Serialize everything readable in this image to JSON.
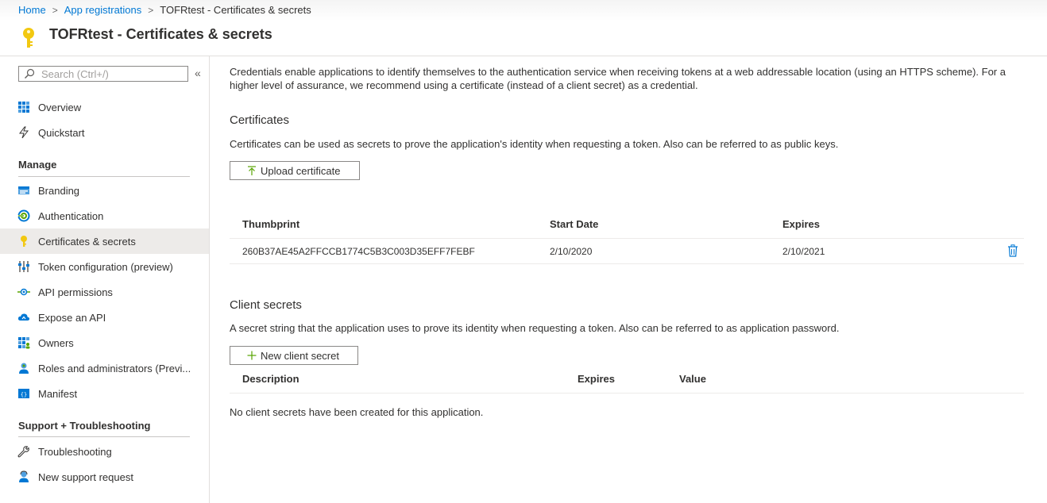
{
  "breadcrumb": {
    "items": [
      "Home",
      "App registrations",
      "TOFRtest - Certificates & secrets"
    ]
  },
  "page": {
    "title": "TOFRtest - Certificates & secrets",
    "intro": "Credentials enable applications to identify themselves to the authentication service when receiving tokens at a web addressable location (using an HTTPS scheme). For a higher level of assurance, we recommend using a certificate (instead of a client secret) as a credential."
  },
  "sidebar": {
    "search_placeholder": "Search (Ctrl+/)",
    "collapse_glyph": "«",
    "top_items": [
      {
        "label": "Overview",
        "icon": "grid-icon"
      },
      {
        "label": "Quickstart",
        "icon": "lightning-icon"
      }
    ],
    "manage_header": "Manage",
    "manage_items": [
      {
        "label": "Branding",
        "icon": "branding-icon"
      },
      {
        "label": "Authentication",
        "icon": "authentication-icon"
      },
      {
        "label": "Certificates & secrets",
        "icon": "key-icon",
        "active": true
      },
      {
        "label": "Token configuration (preview)",
        "icon": "token-config-icon"
      },
      {
        "label": "API permissions",
        "icon": "api-permissions-icon"
      },
      {
        "label": "Expose an API",
        "icon": "cloud-icon"
      },
      {
        "label": "Owners",
        "icon": "owners-icon"
      },
      {
        "label": "Roles and administrators (Previ...",
        "icon": "roles-icon"
      },
      {
        "label": "Manifest",
        "icon": "manifest-icon"
      }
    ],
    "support_header": "Support + Troubleshooting",
    "support_items": [
      {
        "label": "Troubleshooting",
        "icon": "wrench-icon"
      },
      {
        "label": "New support request",
        "icon": "support-person-icon"
      }
    ]
  },
  "certificates": {
    "heading": "Certificates",
    "description": "Certificates can be used as secrets to prove the application's identity when requesting a token. Also can be referred to as public keys.",
    "upload_button": "Upload certificate",
    "columns": [
      "Thumbprint",
      "Start Date",
      "Expires"
    ],
    "rows": [
      {
        "thumbprint": "260B37AE45A2FFCCB1774C5B3C003D35EFF7FEBF",
        "start": "2/10/2020",
        "expires": "2/10/2021"
      }
    ]
  },
  "client_secrets": {
    "heading": "Client secrets",
    "description": "A secret string that the application uses to prove its identity when requesting a token. Also can be referred to as application password.",
    "new_button": "New client secret",
    "columns": [
      "Description",
      "Expires",
      "Value"
    ],
    "empty_text": "No client secrets have been created for this application."
  },
  "colors": {
    "link": "#0078d4",
    "key": "#f2c811",
    "active_bg": "#edebe9",
    "upload_arrow": "#57a300",
    "plus": "#57a300"
  }
}
